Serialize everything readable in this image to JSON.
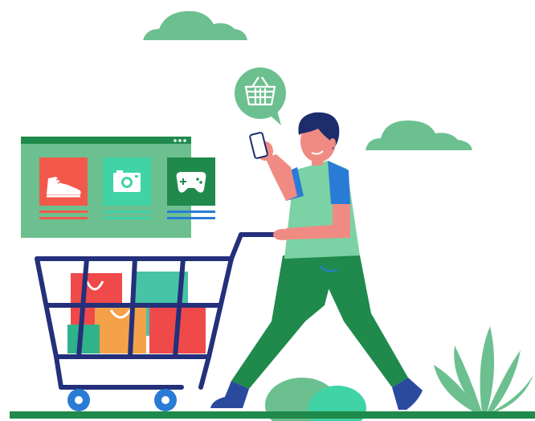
{
  "colors": {
    "background": "#ffffff",
    "cloud": "#6cc08f",
    "ground": "#1f8a4c",
    "speech_bubble": "#6cc08f",
    "basket_icon": "#ffffff",
    "browser_panel": "#6cc08f",
    "browser_topbar": "#1f8a4c",
    "product_red": "#f2594b",
    "product_teal": "#3fd3a5",
    "product_green": "#1f8a4c",
    "cart_frame": "#24307a",
    "cart_wheel": "#2a7bd6",
    "bag_red": "#f06a3c",
    "bag_orange": "#f4a14a",
    "bag_teal": "#47c3a6",
    "box_red": "#f0494a",
    "box_green": "#2fb38a",
    "person_skin": "#f08b83",
    "person_hair": "#1d2c6b",
    "person_shirt": "#7bd2a4",
    "person_sleeve": "#2a7bd6",
    "person_pants": "#1f8a4c",
    "person_shoes": "#2a4a9e",
    "phone": "#ffffff",
    "plant": "#6cc08f",
    "bush": "#3fd3a5"
  },
  "icons": [
    "cloud-icon",
    "shopping-basket-icon",
    "sneaker-icon",
    "camera-icon",
    "gamepad-icon",
    "shopping-cart-icon",
    "plant-icon"
  ]
}
